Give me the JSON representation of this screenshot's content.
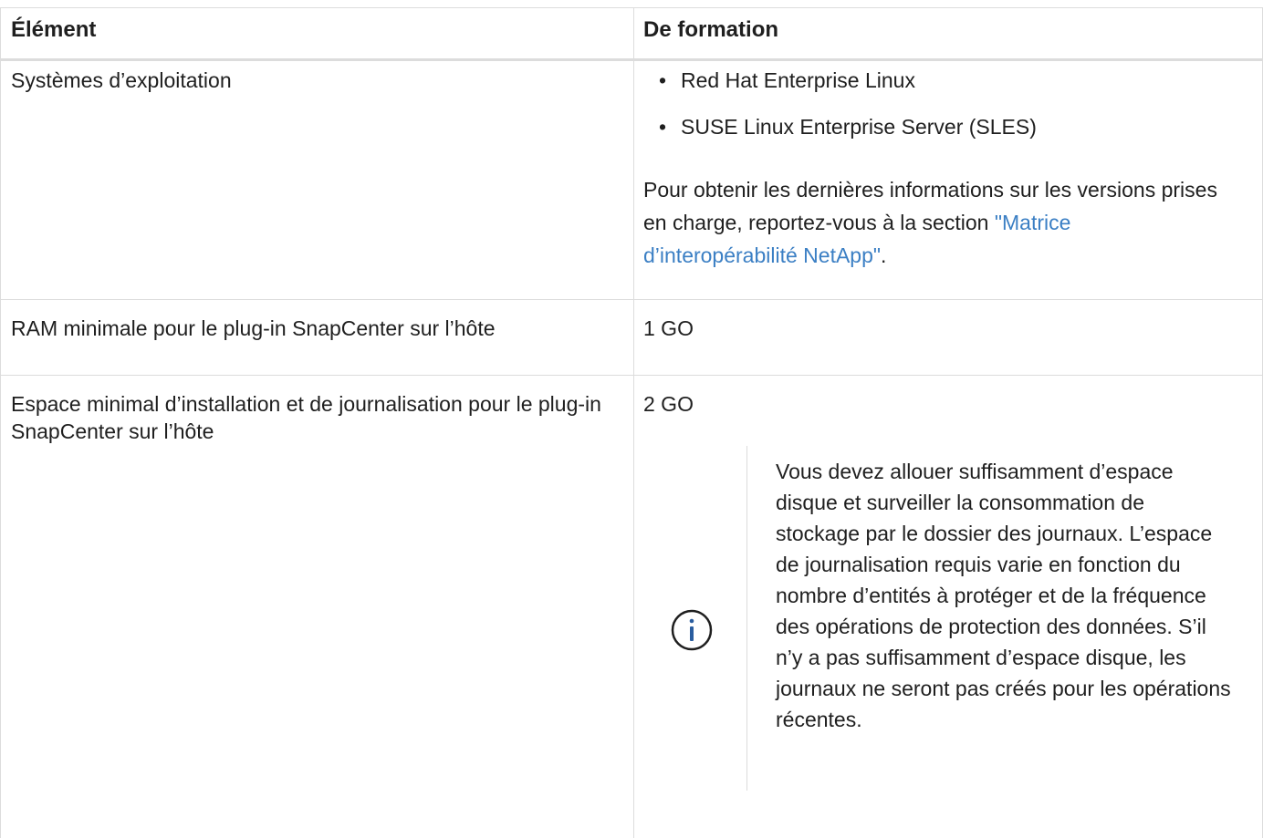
{
  "header": {
    "col1": "Élément",
    "col2": "De formation"
  },
  "rows": [
    {
      "label": "Systèmes d’exploitation",
      "bullets": [
        "Red Hat Enterprise Linux",
        "SUSE Linux Enterprise Server (SLES)"
      ],
      "para_text": "Pour obtenir les dernières informations sur les versions prises en charge, reportez-vous à la section ",
      "para_link": "\"Matrice d’interopérabilité NetApp\"",
      "para_end": "."
    },
    {
      "label": "RAM minimale pour le plug-in SnapCenter sur l’hôte",
      "value": "1 GO"
    },
    {
      "label": "Espace minimal d’installation et de journalisation pour le plug-in SnapCenter sur l’hôte",
      "value": "2 GO",
      "note": "Vous devez allouer suffisamment d’espace disque et surveiller la consommation de stockage par le dossier des journaux. L’espace de journalisation requis varie en fonction du nombre d’entités à protéger et de la fréquence des opérations de protection des données. S’il n’y a pas suffisamment d’espace disque, les journaux ne seront pas créés pour les opérations récentes.",
      "note_icon": "info-circle-icon"
    }
  ],
  "colors": {
    "link": "#3b7fc4",
    "icon": "#2a5d9f",
    "border": "#dcdcdc"
  }
}
